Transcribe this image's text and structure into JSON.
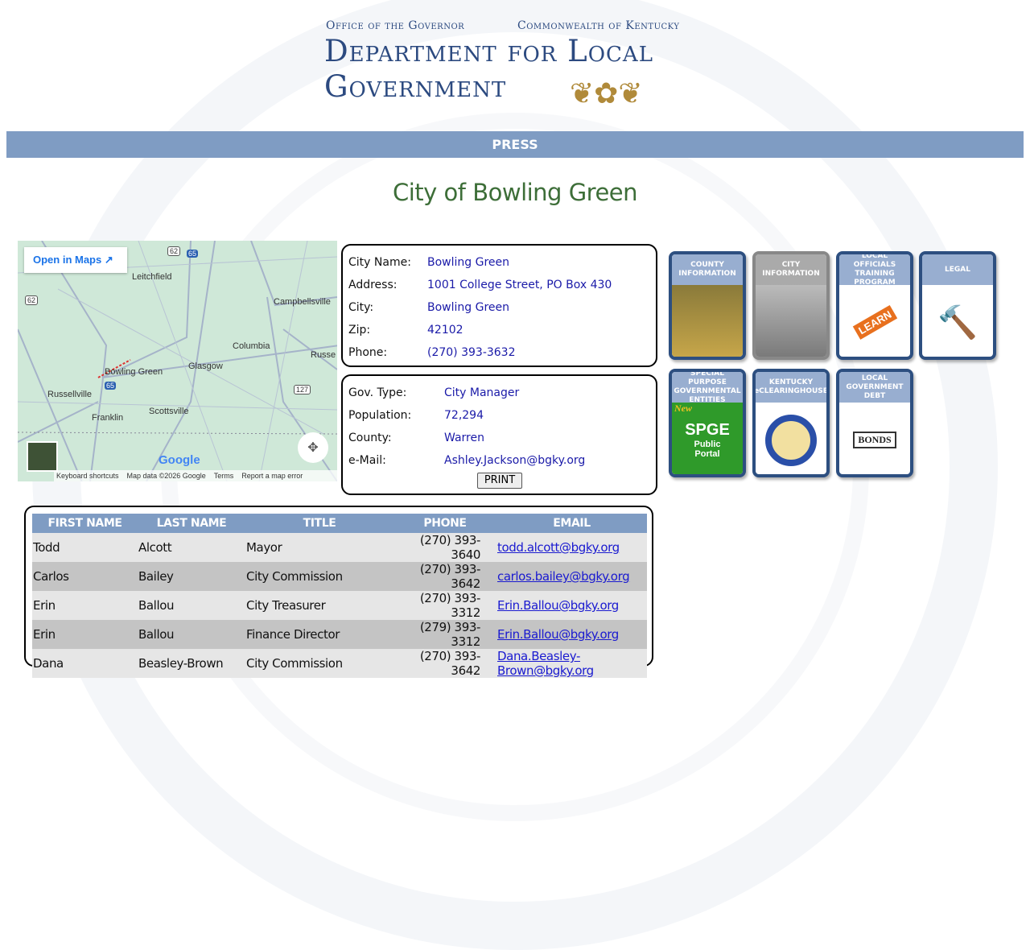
{
  "header": {
    "office": "Office of the Governor",
    "commonwealth": "Commonwealth of Kentucky",
    "dept_line1": "Department for Local",
    "dept_line2": "Government"
  },
  "nav": {
    "press": "PRESS"
  },
  "page_title": "City of Bowling Green",
  "map": {
    "open_in_maps": "Open in Maps",
    "labels": [
      "Leitchfield",
      "Campbellsville",
      "Columbia",
      "Russe",
      "Bowling Green",
      "Glasgow",
      "Russellville",
      "Franklin",
      "Scottsville"
    ],
    "shields": [
      "62",
      "65",
      "62",
      "65",
      "127"
    ],
    "google": "Google",
    "footer": [
      "Keyboard shortcuts",
      "Map data ©2026 Google",
      "Terms",
      "Report a map error"
    ]
  },
  "city_info": [
    {
      "label": "City Name:",
      "value": "Bowling Green"
    },
    {
      "label": "Address:",
      "value": "1001 College Street, PO Box 430"
    },
    {
      "label": "City:",
      "value": "Bowling Green"
    },
    {
      "label": "Zip:",
      "value": "42102"
    },
    {
      "label": "Phone:",
      "value": "(270) 393-3632"
    }
  ],
  "gov_info": [
    {
      "label": "Gov. Type:",
      "value": "City Manager"
    },
    {
      "label": "Population:",
      "value": "72,294"
    },
    {
      "label": "County:",
      "value": "Warren"
    },
    {
      "label": "e-Mail:",
      "value": "Ashley.Jackson@bgky.org"
    }
  ],
  "print_label": "PRINT",
  "tiles": [
    {
      "title": "COUNTY INFORMATION"
    },
    {
      "title": "CITY INFORMATION"
    },
    {
      "title": "LOCAL OFFICIALS TRAINING PROGRAM",
      "img": "LEARN"
    },
    {
      "title": "LEGAL"
    },
    {
      "title": "SPECIAL PURPOSE GOVERNMENTAL ENTITIES",
      "new": "New",
      "big": "SPGE",
      "sub": "Public Portal"
    },
    {
      "title": "KENTUCKY eCLEARINGHOUSE"
    },
    {
      "title": "LOCAL GOVERNMENT DEBT",
      "img": "BONDS"
    }
  ],
  "officials": {
    "headers": [
      "FIRST NAME",
      "LAST NAME",
      "TITLE",
      "PHONE",
      "EMAIL"
    ],
    "rows": [
      [
        "Todd",
        "Alcott",
        "Mayor",
        "(270) 393-3640",
        "todd.alcott@bgky.org"
      ],
      [
        "Carlos",
        "Bailey",
        "City Commission",
        "(270) 393-3642",
        "carlos.bailey@bgky.org"
      ],
      [
        "Erin",
        "Ballou",
        "City Treasurer",
        "(270) 393-3312",
        "Erin.Ballou@bgky.org"
      ],
      [
        "Erin",
        "Ballou",
        "Finance Director",
        "(279) 393-3312",
        "Erin.Ballou@bgky.org"
      ],
      [
        "Dana",
        "Beasley-Brown",
        "City Commission",
        "(270) 393-3642",
        "Dana.Beasley-Brown@bgky.org"
      ]
    ]
  }
}
